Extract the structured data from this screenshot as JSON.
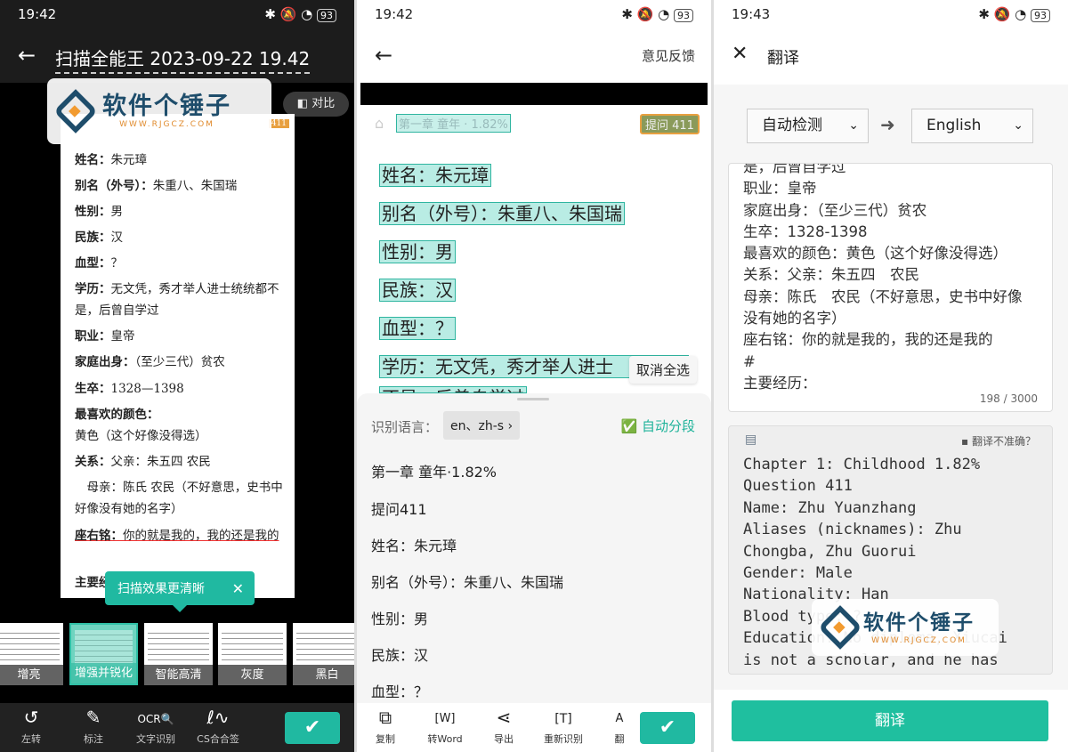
{
  "watermark": {
    "brand": "软件个锤子",
    "url": "WWW.RJGCZ.COM"
  },
  "panel1": {
    "status": {
      "time": "19:42",
      "battery": "93"
    },
    "title": "扫描全能王 2023-09-22 19.42",
    "compare_label": "对比",
    "doc_badge": "411",
    "doc_lines": [
      {
        "k": "姓名：",
        "v": "朱元璋"
      },
      {
        "k": "别名（外号）：",
        "v": "朱重八、朱国瑞"
      },
      {
        "k": "性别：",
        "v": "男"
      },
      {
        "k": "民族：",
        "v": "汉"
      },
      {
        "k": "血型：",
        "v": "？"
      },
      {
        "k": "学历：",
        "v": "无文凭，秀才举人进士统统都不是，后曾自学过"
      },
      {
        "k": "职业：",
        "v": "皇帝"
      },
      {
        "k": "家庭出身：",
        "v": "（至少三代）贫农"
      },
      {
        "k": "生卒：",
        "v": "1328—1398"
      },
      {
        "k": "最喜欢的颜色：",
        "v": "黄色（这个好像没得选）"
      },
      {
        "k": "关系：",
        "v": "父亲：朱五四 农民"
      },
      {
        "k": "",
        "v": "　母亲：陈氏 农民（不好意思，史书中好像没有她的名字）"
      },
      {
        "k": "座右铭：",
        "v": "你的就是我的，我的还是我的"
      },
      {
        "k": "主要经",
        "v": ""
      }
    ],
    "tooltip": "扫描效果更清晰",
    "filters": [
      "增亮",
      "增强并锐化",
      "智能高清",
      "灰度",
      "黑白"
    ],
    "selected_filter": "增强并锐化",
    "toolbar": [
      "左转",
      "标注",
      "文字识别",
      "CS合合签"
    ]
  },
  "panel2": {
    "status": {
      "time": "19:42",
      "battery": "93"
    },
    "feedback": "意见反馈",
    "doc_header": "第一章 童年 · 1.82%",
    "doc_badge": "提问 411",
    "highlights": [
      "姓名：朱元璋",
      "别名（外号）：朱重八、朱国瑞",
      "性别：男",
      "民族：汉",
      "血型：？",
      "学历：无文凭，秀才举人进士",
      "不是，后曾自学过"
    ],
    "context_menu": "取消全选",
    "lang_label": "识别语言：",
    "lang_value": "en、zh-s",
    "auto_paragraph": "自动分段",
    "results": [
      "第一章 童年·1.82%",
      "提问411",
      "姓名：朱元璋",
      "别名（外号）：朱重八、朱国瑞",
      "性别：男",
      "民族：汉",
      "血型：？"
    ],
    "toolbar": [
      "复制",
      "转Word",
      "导出",
      "重新识别",
      "翻"
    ]
  },
  "panel3": {
    "status": {
      "time": "19:43",
      "battery": "93"
    },
    "title": "翻译",
    "source_lang": "自动检测",
    "target_lang": "English",
    "source_lines": [
      "是，后曾自学过",
      "职业：皇帝",
      "家庭出身：（至少三代）贫农",
      "生卒：1328-1398",
      "最喜欢的颜色：黄色（这个好像没得选）",
      "关系：父亲：朱五四　农民",
      "母亲：陈氏　农民（不好意思，史书中好像",
      "没有她的名字）",
      "座右铭：你的就是我的，我的还是我的",
      "#",
      "主要经历："
    ],
    "char_count": "198 / 3000",
    "inaccurate": "翻译不准确？",
    "translation": "Chapter 1: Childhood 1.82%\nQuestion 411\nName: Zhu Yuanzhang\nAliases (nicknames): Zhu\nChongba, Zhu Guorui\nGender: Male\nNationality: Han\nBlood type: ?\nEducation: No diploma, Xiucai\nis not a scholar, and he has",
    "translate_button": "翻译"
  },
  "colors": {
    "accent": "#1fbf9f",
    "highlight": "#b9ece4",
    "orange": "#e8a040"
  }
}
